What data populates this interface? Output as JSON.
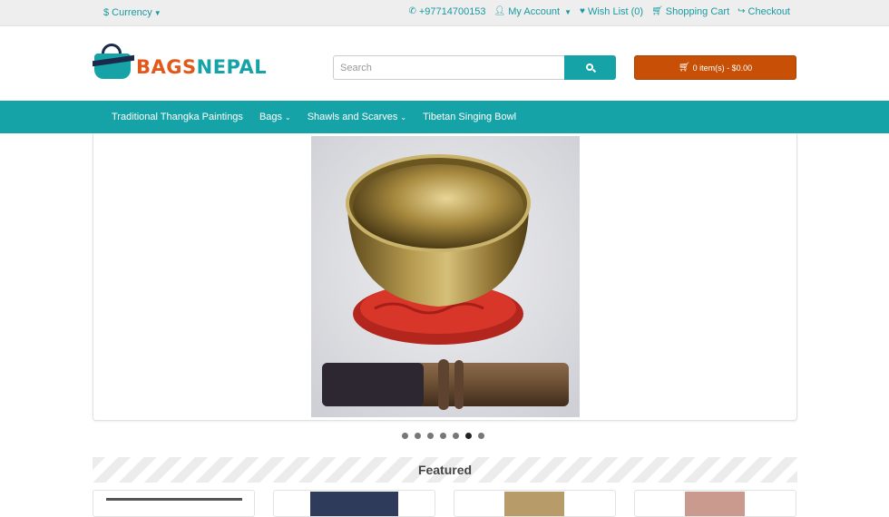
{
  "topbar": {
    "currency": "$ Currency",
    "phone": "+97714700153",
    "my_account": "My Account",
    "wish_list": "Wish List (0)",
    "shopping_cart": "Shopping Cart",
    "checkout": "Checkout"
  },
  "header": {
    "logo_part1": "BAGS",
    "logo_part2": "NEPAL",
    "search_placeholder": "Search",
    "cart_label": "0 item(s) - $0.00"
  },
  "nav": {
    "items": [
      {
        "label": "Traditional Thangka Paintings",
        "has_dropdown": false
      },
      {
        "label": "Bags",
        "has_dropdown": true
      },
      {
        "label": "Shawls and Scarves",
        "has_dropdown": true
      },
      {
        "label": "Tibetan Singing Bowl",
        "has_dropdown": false
      }
    ]
  },
  "slider": {
    "image": "singing-bowl-photo",
    "dot_count": 7,
    "active_dot": 6
  },
  "featured": {
    "heading": "Featured"
  },
  "colors": {
    "accent": "#16a3a7",
    "cart": "#c74f06",
    "logo_orange": "#e2581b"
  }
}
